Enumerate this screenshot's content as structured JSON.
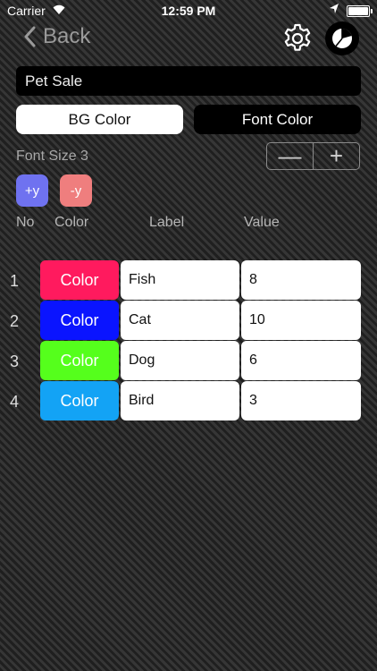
{
  "status_bar": {
    "carrier": "Carrier",
    "time": "12:59 PM"
  },
  "nav": {
    "back_label": "Back"
  },
  "chart_title": "Pet Sale",
  "segments": {
    "bg_color": "BG Color",
    "font_color": "Font Color",
    "selected": "BG Color"
  },
  "font_size_label": "Font Size 3",
  "stepper": {
    "minus": "—",
    "plus": "+"
  },
  "y_buttons": {
    "plus": "+y",
    "minus": "-y"
  },
  "headers": {
    "no": "No",
    "color": "Color",
    "label": "Label",
    "value": "Value"
  },
  "rows": [
    {
      "no": "1",
      "color_label": "Color",
      "color": "#ff1a5e",
      "label": "Fish",
      "value": "8"
    },
    {
      "no": "2",
      "color_label": "Color",
      "color": "#0a14ff",
      "label": "Cat",
      "value": "10"
    },
    {
      "no": "3",
      "color_label": "Color",
      "color": "#55ff1c",
      "label": "Dog",
      "value": "6"
    },
    {
      "no": "4",
      "color_label": "Color",
      "color": "#13a3f5",
      "label": "Bird",
      "value": "3"
    }
  ]
}
